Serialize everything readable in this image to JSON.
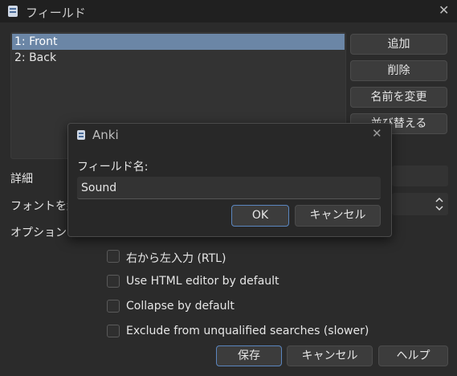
{
  "window": {
    "title": "フィールド",
    "close_glyph": "✕"
  },
  "fields": [
    "1: Front",
    "2: Back"
  ],
  "side_buttons": {
    "add": "追加",
    "delete": "削除",
    "rename": "名前を変更",
    "reposition": "並び替える"
  },
  "labels": {
    "description": "詳細",
    "font": "フォントを編集",
    "options": "オプション"
  },
  "options": [
    {
      "label": "右から左入力 (RTL)",
      "checked": false
    },
    {
      "label": "Use HTML editor by default",
      "checked": false
    },
    {
      "label": "Collapse by default",
      "checked": false
    },
    {
      "label": "Exclude from unqualified searches (slower)",
      "checked": false
    }
  ],
  "bottom_buttons": {
    "save": "保存",
    "cancel": "キャンセル",
    "help": "ヘルプ"
  },
  "dialog": {
    "title": "Anki",
    "close_glyph": "✕",
    "label": "フィールド名:",
    "value": "Sound",
    "ok": "OK",
    "cancel": "キャンセル"
  },
  "colors": {
    "accent": "#5b86bf",
    "selection": "#6b86a6",
    "background": "#2b2b2b"
  },
  "icons": {
    "app": "anki-icon",
    "spinner": "spin-arrows-icon"
  }
}
